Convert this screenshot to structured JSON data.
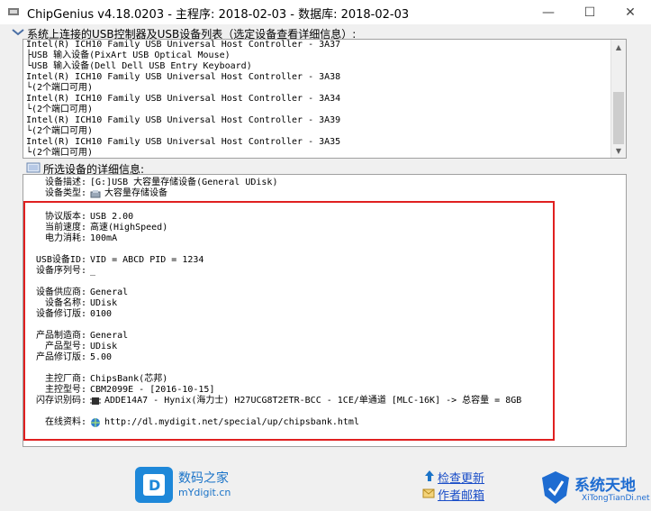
{
  "window": {
    "title": "ChipGenius v4.18.0203 - 主程序: 2018-02-03 - 数据库: 2018-02-03",
    "minimize_glyph": "—",
    "maximize_glyph": "☐",
    "close_glyph": "✕"
  },
  "usb_section": {
    "label": "系统上连接的USB控制器及USB设备列表（选定设备查看详细信息）:",
    "items": [
      "Intel(R) ICH10 Family USB Universal Host Controller - 3A37",
      "├USB 输入设备(PixArt USB Optical Mouse)",
      "└USB 输入设备(Dell Dell USB Entry Keyboard)",
      "Intel(R) ICH10 Family USB Universal Host Controller - 3A38",
      "└(2个端口可用)",
      "Intel(R) ICH10 Family USB Universal Host Controller - 3A34",
      "└(2个端口可用)",
      "Intel(R) ICH10 Family USB Universal Host Controller - 3A39",
      "└(2个端口可用)",
      "Intel(R) ICH10 Family USB Universal Host Controller - 3A35",
      "└(2个端口可用)"
    ]
  },
  "detail_section": {
    "label": "所选设备的详细信息:",
    "rows": [
      {
        "key": "设备描述:",
        "value": "[G:]USB 大容量存储设备(General UDisk)"
      },
      {
        "key": "设备类型:",
        "value": "大容量存储设备"
      },
      {
        "key": "协议版本:",
        "value": "USB 2.00"
      },
      {
        "key": "当前速度:",
        "value": "高速(HighSpeed)"
      },
      {
        "key": "电力消耗:",
        "value": "100mA"
      },
      {
        "key": "USB设备ID:",
        "value": "VID = ABCD PID = 1234"
      },
      {
        "key": "设备序列号:",
        "value": "_"
      },
      {
        "key": "设备供应商:",
        "value": "General"
      },
      {
        "key": "设备名称:",
        "value": "UDisk"
      },
      {
        "key": "设备修订版:",
        "value": "0100"
      },
      {
        "key": "产品制造商:",
        "value": "General"
      },
      {
        "key": "产品型号:",
        "value": "UDisk"
      },
      {
        "key": "产品修订版:",
        "value": "5.00"
      },
      {
        "key": "主控厂商:",
        "value": "ChipsBank(芯邦)"
      },
      {
        "key": "主控型号:",
        "value": "CBM2099E - [2016-10-15]"
      },
      {
        "key": "闪存识别码:",
        "value": "ADDE14A7 - Hynix(海力士) H27UCG8T2ETR-BCC - 1CE/单通道 [MLC-16K] -> 总容量 = 8GB"
      },
      {
        "key": "在线资料:",
        "value": "http://dl.mydigit.net/special/up/chipsbank.html"
      }
    ]
  },
  "footer": {
    "site_name": "数码之家",
    "site_url": "mYdigit.cn",
    "check_update": "检查更新",
    "author_mail": "作者邮箱",
    "watermark_title": "系统天地",
    "watermark_url": "XiTongTianDi.net"
  }
}
